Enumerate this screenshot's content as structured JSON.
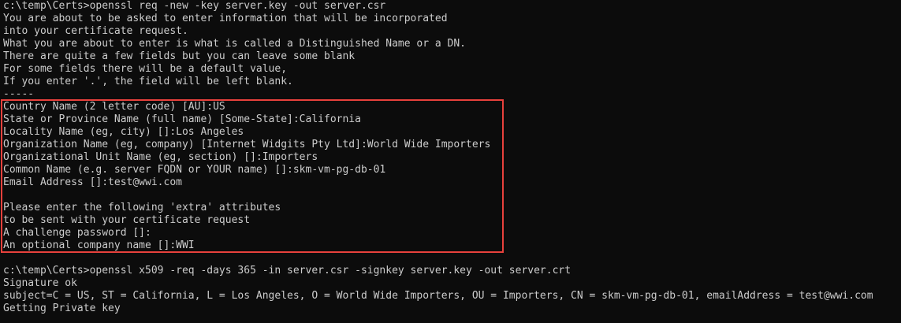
{
  "terminal": {
    "lines": [
      "c:\\temp\\Certs>openssl req -new -key server.key -out server.csr",
      "You are about to be asked to enter information that will be incorporated",
      "into your certificate request.",
      "What you are about to enter is what is called a Distinguished Name or a DN.",
      "There are quite a few fields but you can leave some blank",
      "For some fields there will be a default value,",
      "If you enter '.', the field will be left blank.",
      "-----",
      "Country Name (2 letter code) [AU]:US",
      "State or Province Name (full name) [Some-State]:California",
      "Locality Name (eg, city) []:Los Angeles",
      "Organization Name (eg, company) [Internet Widgits Pty Ltd]:World Wide Importers",
      "Organizational Unit Name (eg, section) []:Importers",
      "Common Name (e.g. server FQDN or YOUR name) []:skm-vm-pg-db-01",
      "Email Address []:test@wwi.com",
      "",
      "Please enter the following 'extra' attributes",
      "to be sent with your certificate request",
      "A challenge password []:",
      "An optional company name []:WWI",
      "",
      "c:\\temp\\Certs>openssl x509 -req -days 365 -in server.csr -signkey server.key -out server.crt",
      "Signature ok",
      "subject=C = US, ST = California, L = Los Angeles, O = World Wide Importers, OU = Importers, CN = skm-vm-pg-db-01, emailAddress = test@wwi.com",
      "Getting Private key"
    ]
  },
  "colors": {
    "background": "#0c0c0c",
    "text": "#cccccc",
    "highlight_border": "#e8413c"
  }
}
